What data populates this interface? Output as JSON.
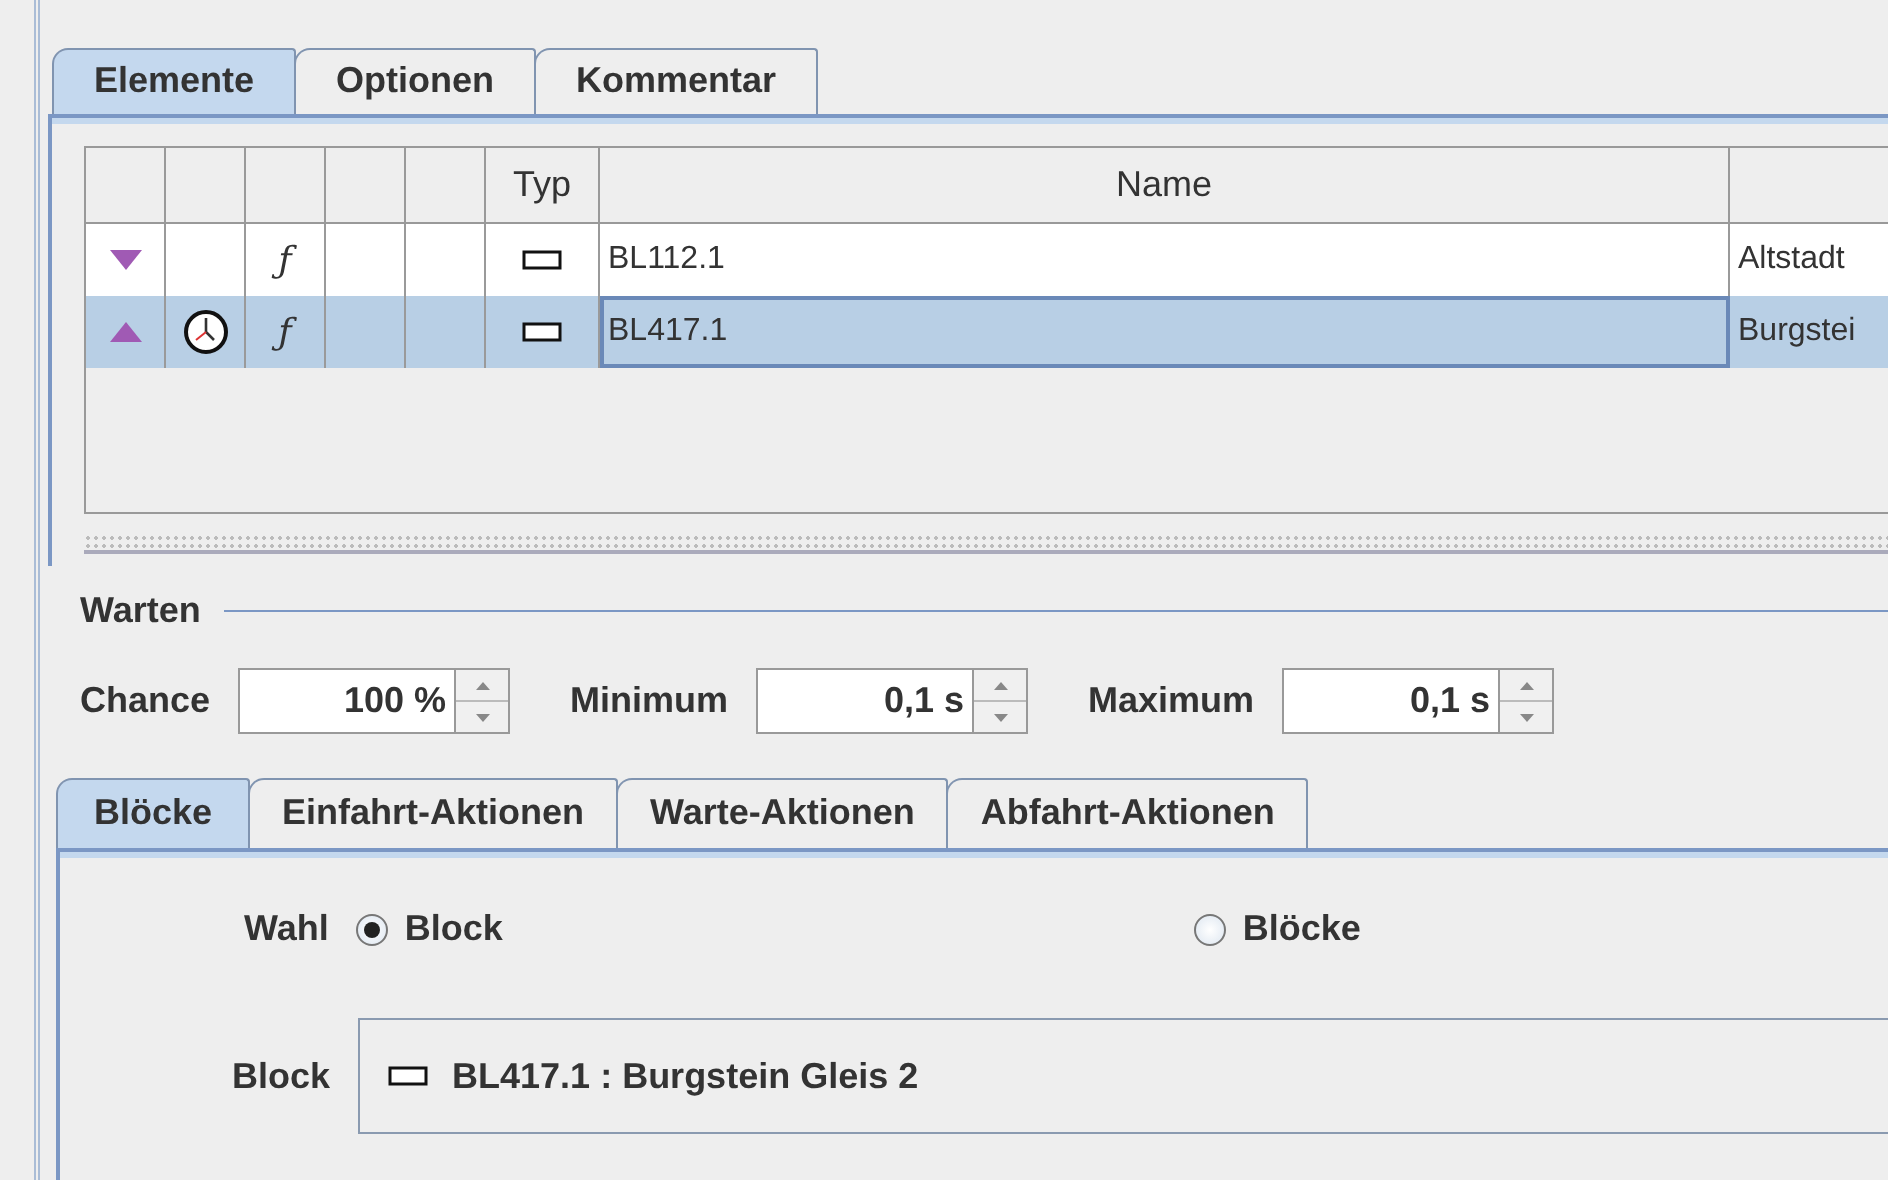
{
  "tabs": [
    {
      "label": "Elemente",
      "selected": true
    },
    {
      "label": "Optionen",
      "selected": false
    },
    {
      "label": "Kommentar",
      "selected": false
    }
  ],
  "table": {
    "columns": [
      {
        "label": "Typ"
      },
      {
        "label": "Name"
      }
    ],
    "rows": [
      {
        "kind": "down",
        "has_timer": false,
        "function_mark": "ƒ",
        "name": "BL112.1",
        "column_8": "Altstadt",
        "selected": false
      },
      {
        "kind": "up",
        "has_timer": true,
        "function_mark": "ƒ",
        "name": "BL417.1",
        "column_8": "Burgstei",
        "selected": true
      }
    ]
  },
  "wait": {
    "title": "Warten",
    "fields": [
      {
        "label": "Chance",
        "value": "100 %"
      },
      {
        "label": "Minimum",
        "value": "0,1 s"
      },
      {
        "label": "Maximum",
        "value": "0,1 s"
      }
    ]
  },
  "action_tabs": [
    {
      "label": "Blöcke",
      "selected": true
    },
    {
      "label": "Einfahrt-Aktionen",
      "selected": false
    },
    {
      "label": "Warte-Aktionen",
      "selected": false
    },
    {
      "label": "Abfahrt-Aktionen",
      "selected": false
    }
  ],
  "selection": {
    "label": "Wahl",
    "options": [
      {
        "label": "Block",
        "selected": true
      },
      {
        "label": "Blöcke",
        "selected": false
      }
    ]
  },
  "block": {
    "label": "Block",
    "value": "BL417.1 : Burgstein Gleis 2"
  }
}
